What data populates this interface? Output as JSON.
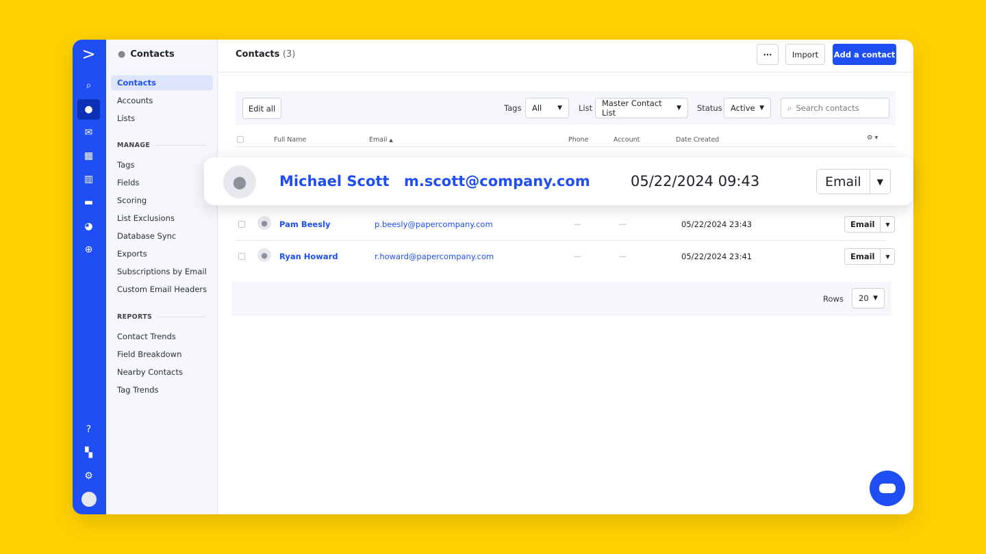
{
  "rail": {
    "icons": [
      "logo-icon",
      "search-icon",
      "contacts-icon",
      "email-icon",
      "automations-icon",
      "pipelines-icon",
      "website-icon",
      "reports-icon",
      "upgrade-icon",
      "help-icon",
      "apps-icon",
      "settings-icon",
      "avatar-icon"
    ]
  },
  "sidebar": {
    "title": "Contacts",
    "items": [
      {
        "label": "Contacts",
        "active": true
      },
      {
        "label": "Accounts"
      },
      {
        "label": "Lists"
      }
    ],
    "manage_title": "MANAGE",
    "manage": [
      "Tags",
      "Fields",
      "Scoring",
      "List Exclusions",
      "Database Sync",
      "Exports",
      "Subscriptions by Email",
      "Custom Email Headers"
    ],
    "reports_title": "REPORTS",
    "reports": [
      "Contact Trends",
      "Field Breakdown",
      "Nearby Contacts",
      "Tag Trends"
    ]
  },
  "header": {
    "title": "Contacts",
    "count": "(3)",
    "more": "···",
    "import": "Import",
    "add": "Add a contact"
  },
  "filters": {
    "edit_all": "Edit all",
    "tags_label": "Tags",
    "tags_value": "All",
    "list_label": "List",
    "list_value": "Master Contact List",
    "status_label": "Status",
    "status_value": "Active",
    "search_placeholder": "Search contacts"
  },
  "table": {
    "columns": [
      "Full Name",
      "Email",
      "Phone",
      "Account",
      "Date Created"
    ],
    "rows": [
      {
        "name": "Pam Beesly",
        "email": "p.beesly@papercompany.com",
        "phone": "—",
        "account": "—",
        "date": "05/22/2024 23:43",
        "action": "Email"
      },
      {
        "name": "Ryan Howard",
        "email": "r.howard@papercompany.com",
        "phone": "—",
        "account": "—",
        "date": "05/22/2024 23:41",
        "action": "Email"
      }
    ]
  },
  "highlight": {
    "name": "Michael Scott",
    "email": "m.scott@company.com",
    "date": "05/22/2024 09:43",
    "action": "Email"
  },
  "footer": {
    "rows_label": "Rows",
    "rows_value": "20"
  },
  "colors": {
    "background": "#FFD000",
    "brand": "#1F4EF5"
  }
}
